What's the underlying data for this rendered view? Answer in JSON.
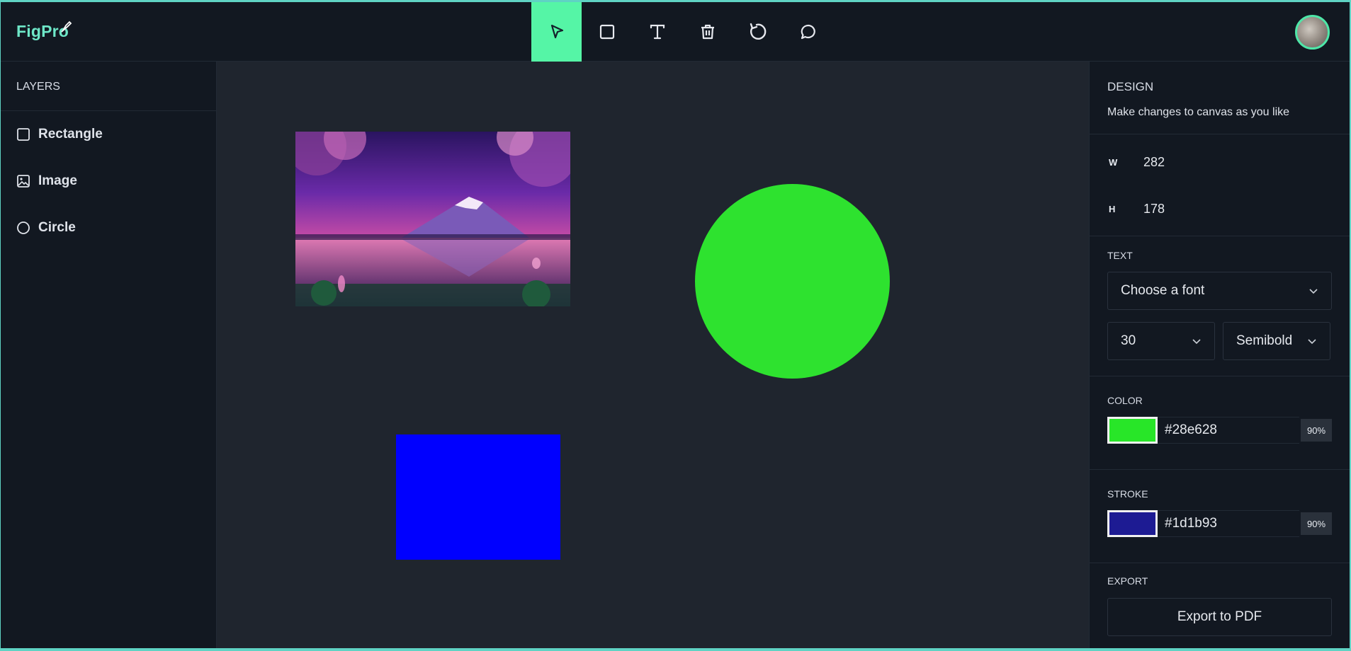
{
  "app": {
    "logo_text": "FigPro"
  },
  "toolbar": {
    "tools": [
      {
        "name": "select",
        "icon": "cursor-icon",
        "active": true
      },
      {
        "name": "rectangle",
        "icon": "square-icon",
        "active": false
      },
      {
        "name": "text",
        "icon": "text-icon",
        "active": false
      },
      {
        "name": "delete",
        "icon": "trash-icon",
        "active": false
      },
      {
        "name": "reset",
        "icon": "rotate-icon",
        "active": false
      },
      {
        "name": "comments",
        "icon": "comment-icon",
        "active": false
      }
    ],
    "active_color": "#55f5a6"
  },
  "layers": {
    "title": "LAYERS",
    "items": [
      {
        "label": "Rectangle",
        "icon": "square-icon"
      },
      {
        "label": "Image",
        "icon": "image-icon"
      },
      {
        "label": "Circle",
        "icon": "circle-icon"
      }
    ]
  },
  "canvas": {
    "background": "#1f252e",
    "objects": [
      {
        "type": "image",
        "description": "mountain-lake-sunset"
      },
      {
        "type": "circle",
        "fill": "#2ee22f"
      },
      {
        "type": "rectangle",
        "fill": "#0000ff"
      }
    ]
  },
  "design": {
    "title": "DESIGN",
    "subtitle": "Make changes to canvas as you like",
    "width_label": "W",
    "width_value": "282",
    "height_label": "H",
    "height_value": "178"
  },
  "text": {
    "title": "TEXT",
    "font_placeholder": "Choose a font",
    "size": "30",
    "weight": "Semibold"
  },
  "color": {
    "title": "COLOR",
    "swatch": "#28e628",
    "hex": "#28e628",
    "opacity": "90%"
  },
  "stroke": {
    "title": "STROKE",
    "swatch": "#1d1b93",
    "hex": "#1d1b93",
    "opacity": "90%"
  },
  "export": {
    "title": "EXPORT",
    "button_label": "Export to PDF"
  }
}
